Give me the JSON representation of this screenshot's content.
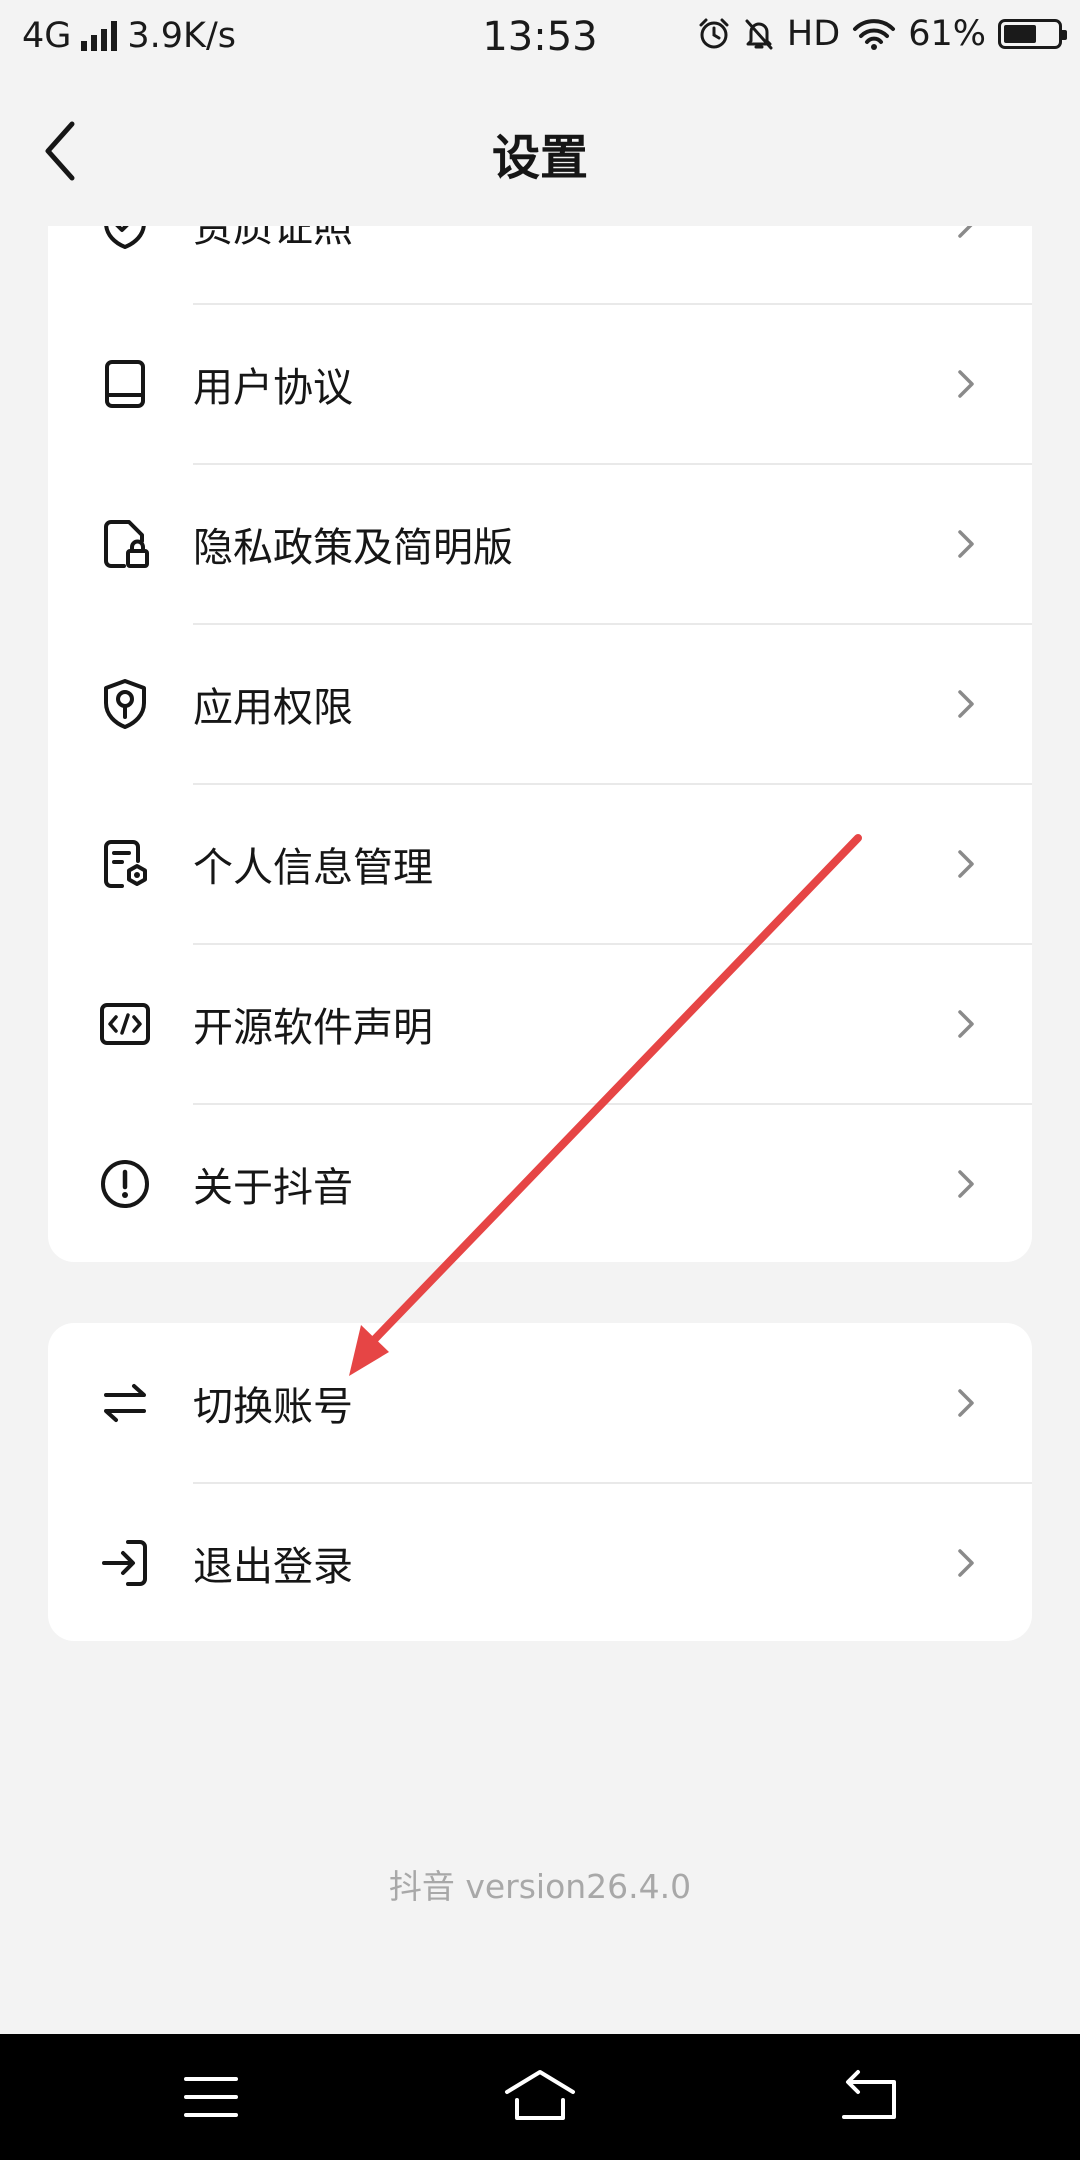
{
  "status_bar": {
    "network": "4G",
    "speed": "3.9K/s",
    "time": "13:53",
    "hd": "HD",
    "battery": "61%",
    "battery_level": 0.61
  },
  "header": {
    "title": "设置"
  },
  "settings_group_1": {
    "items": [
      {
        "label": "资质证照",
        "icon": "shield-check-icon"
      },
      {
        "label": "用户协议",
        "icon": "book-icon"
      },
      {
        "label": "隐私政策及简明版",
        "icon": "file-lock-icon"
      },
      {
        "label": "应用权限",
        "icon": "shield-key-icon"
      },
      {
        "label": "个人信息管理",
        "icon": "file-gear-icon"
      },
      {
        "label": "开源软件声明",
        "icon": "code-icon"
      },
      {
        "label": "关于抖音",
        "icon": "info-circle-icon"
      }
    ]
  },
  "settings_group_2": {
    "items": [
      {
        "label": "切换账号",
        "icon": "swap-arrows-icon"
      },
      {
        "label": "退出登录",
        "icon": "logout-icon"
      }
    ]
  },
  "footer": {
    "version": "抖音 version26.4.0"
  },
  "colors": {
    "annotation_arrow": "#e64545",
    "background": "#f3f3f3",
    "card": "#ffffff"
  }
}
